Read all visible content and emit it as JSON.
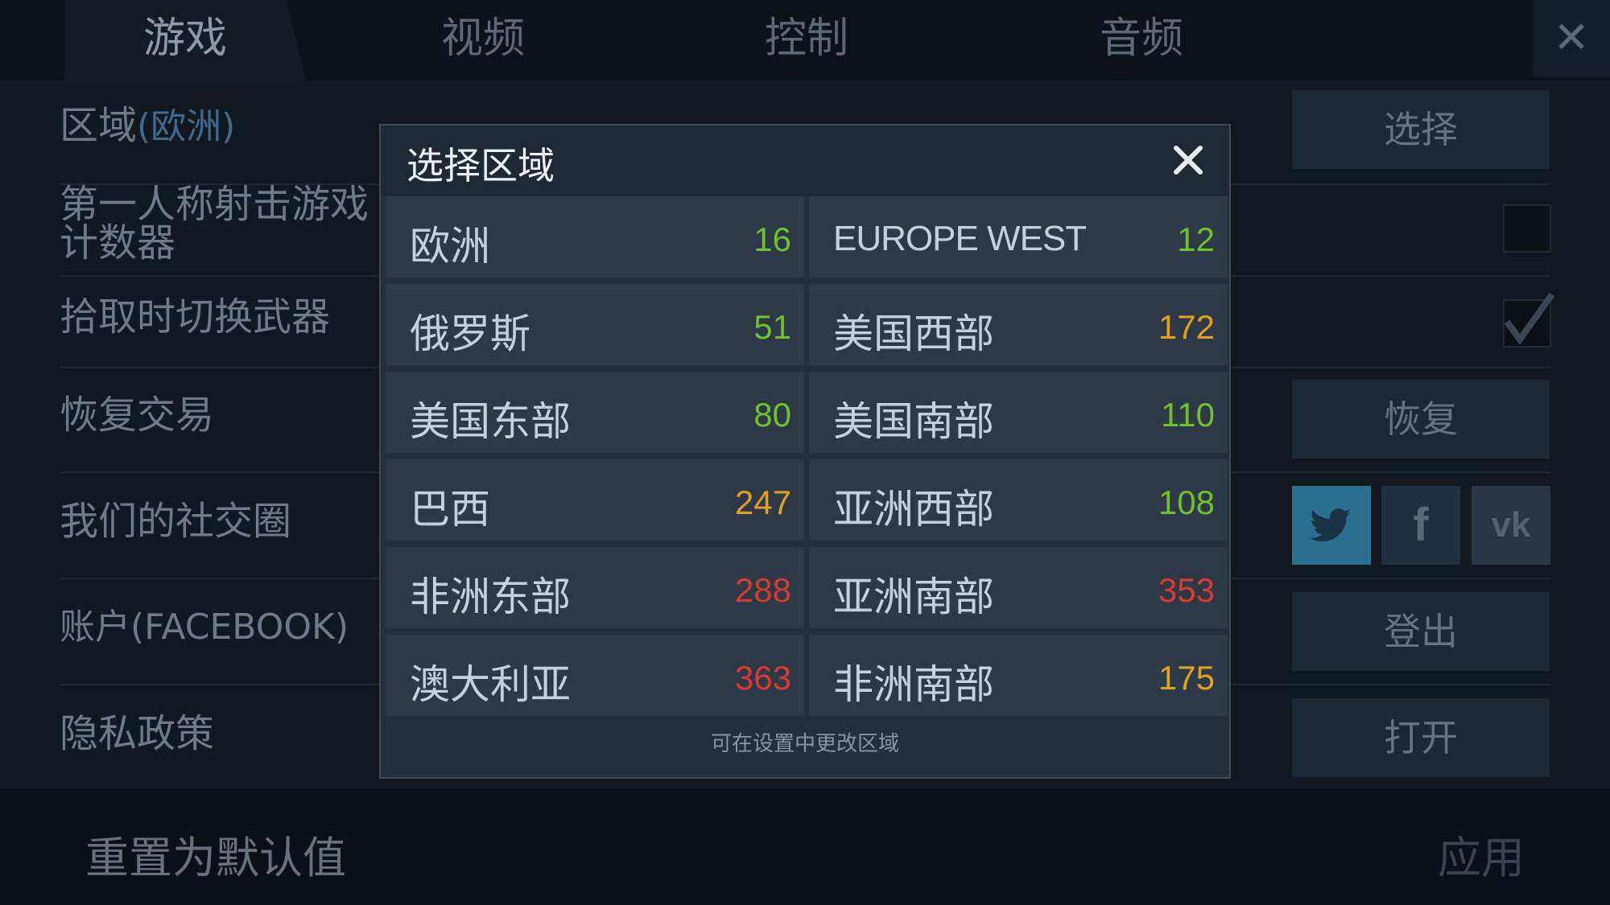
{
  "tabs": [
    "游戏",
    "视频",
    "控制",
    "音频"
  ],
  "close_glyph": "✕",
  "settings": {
    "region_label": "区域",
    "region_value": "(欧洲)",
    "fps_counter_label": "第一人称射击游戏计数器",
    "fps_counter_checked": false,
    "switch_weapon_label": "拾取时切换武器",
    "switch_weapon_checked": true,
    "restore_label": "恢复交易",
    "social_label": "我们的社交圈",
    "account_label": "账户(FACEBOOK)",
    "privacy_label": "隐私政策",
    "select_btn": "选择",
    "restore_btn": "恢复",
    "logout_btn": "登出",
    "open_btn": "打开",
    "social_icons": [
      "twitter-icon",
      "facebook-icon",
      "vk-icon"
    ]
  },
  "bottom": {
    "reset": "重置为默认值",
    "apply": "应用"
  },
  "modal": {
    "title": "选择区域",
    "footer": "可在设置中更改区域",
    "regions": [
      {
        "name": "欧洲",
        "ping": "16",
        "color": "#6fbf2e"
      },
      {
        "name": "EUROPE WEST",
        "ping": "12",
        "color": "#6fbf2e"
      },
      {
        "name": "俄罗斯",
        "ping": "51",
        "color": "#6fbf2e"
      },
      {
        "name": "美国西部",
        "ping": "172",
        "color": "#e0a020"
      },
      {
        "name": "美国东部",
        "ping": "80",
        "color": "#6fbf2e"
      },
      {
        "name": "美国南部",
        "ping": "110",
        "color": "#6fbf2e"
      },
      {
        "name": "巴西",
        "ping": "247",
        "color": "#e0a020"
      },
      {
        "name": "亚洲西部",
        "ping": "108",
        "color": "#6fbf2e"
      },
      {
        "name": "非洲东部",
        "ping": "288",
        "color": "#d83a32"
      },
      {
        "name": "亚洲南部",
        "ping": "353",
        "color": "#d83a32"
      },
      {
        "name": "澳大利亚",
        "ping": "363",
        "color": "#d83a32"
      },
      {
        "name": "非洲南部",
        "ping": "175",
        "color": "#e0a020"
      }
    ]
  },
  "colors": {
    "ping_good": "#6fbf2e",
    "ping_mid": "#e0a020",
    "ping_bad": "#d83a32",
    "twitter": "#2b6f8f",
    "facebook": "#1f2f40",
    "vk": "#2a3644"
  }
}
